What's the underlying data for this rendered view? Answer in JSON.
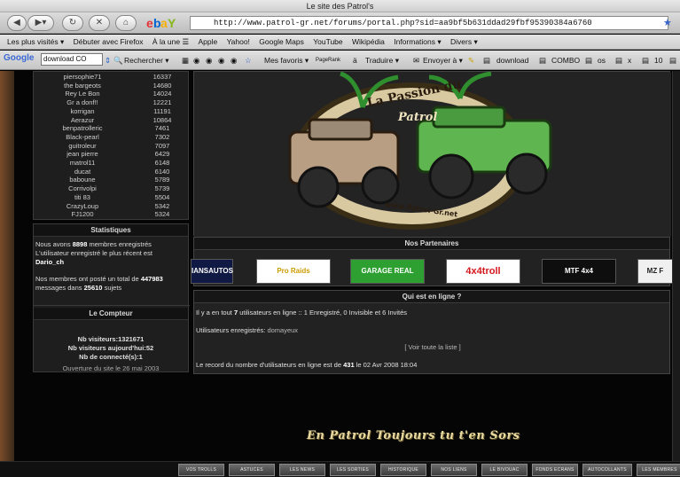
{
  "window": {
    "title": "Le site des Patrol's"
  },
  "url": "http://www.patrol-gr.net/forums/portal.php?sid=aa9bf5b631ddad29fbf95390384a6760",
  "bookmarks": [
    "Les plus visités ▾",
    "Débuter avec Firefox",
    "À la une ☰",
    "Apple",
    "Yahoo!",
    "Google Maps",
    "YouTube",
    "Wikipédia",
    "Informations ▾",
    "Divers ▾"
  ],
  "google_toolbar": {
    "search_value": "download CO",
    "search_label": "Rechercher ▾",
    "favorites": "Mes favoris ▾",
    "pagerank": "PageRank",
    "translate": "Traduire ▾",
    "send": "Envoyer à ▾",
    "items": [
      "download",
      "COMBO",
      "os",
      "x",
      "10"
    ]
  },
  "ranking": [
    {
      "name": "piersophie71",
      "value": "16337"
    },
    {
      "name": "the bargeots",
      "value": "14680"
    },
    {
      "name": "Rey Le Bon",
      "value": "14024"
    },
    {
      "name": "Gr a donf!!",
      "value": "12221"
    },
    {
      "name": "korrigan",
      "value": "11191"
    },
    {
      "name": "Aerazur",
      "value": "10864"
    },
    {
      "name": "benpatrolleric",
      "value": "7461"
    },
    {
      "name": "Black-pearl",
      "value": "7302"
    },
    {
      "name": "guitroleur",
      "value": "7097"
    },
    {
      "name": "jean pierre",
      "value": "6429"
    },
    {
      "name": "matrol11",
      "value": "6148"
    },
    {
      "name": "ducat",
      "value": "6140"
    },
    {
      "name": "baboune",
      "value": "5789"
    },
    {
      "name": "Corrivolpi",
      "value": "5739"
    },
    {
      "name": "titi 83",
      "value": "5504"
    },
    {
      "name": "CrazyLoup",
      "value": "5342"
    },
    {
      "name": "FJ1200",
      "value": "5324"
    }
  ],
  "stats": {
    "title": "Statistiques",
    "l1a": "Nous avons ",
    "members": "8898",
    "l1b": " membres enregistrés",
    "l2": "L'utilisateur enregistré le plus récent est",
    "newest": "Dario_ch",
    "l3a": "Nos membres ont posté un total de ",
    "posts": "447983",
    "l4a": "messages dans ",
    "topics": "25610",
    "l4b": " sujets"
  },
  "counter": {
    "title": "Le Compteur",
    "visitors_label": "Nb visiteurs:",
    "visitors": "1321671",
    "today_label": "Nb visiteurs aujourd'hui:",
    "today": "52",
    "connected_label": "Nb de connecté(s):",
    "connected": "1",
    "opening": "Ouverture du site le 26 mai 2003"
  },
  "logo": {
    "top_text": "La Passion du",
    "middle_text": "Patrol",
    "site_text": "www.Patrol-Gr.net"
  },
  "partners": {
    "title": "Nos Partenaires",
    "banners": [
      "IANSAUTOS",
      "Pro Raids",
      "GARAGE REAL",
      "4x4troll",
      "MTF 4x4",
      "MZ F"
    ]
  },
  "online": {
    "title": "Qui est en ligne ?",
    "line1a": "Il y a en tout ",
    "total": "7",
    "line1b": " utilisateurs en ligne :: 1 Enregistré, 0 Invisible et 6 Invités",
    "registered_label": "Utilisateurs enregistrés: ",
    "registered_user": "domayeux",
    "see_list": "[ Voir toute la liste ]",
    "record_a": "Le record du nombre d'utilisateurs en ligne est de ",
    "record": "431",
    "record_b": " le 02 Avr 2008 18:04"
  },
  "slogan": "En Patrol Toujours tu t'en Sors",
  "bottom_nav": [
    "VOS TROLLS",
    "ASTUCES",
    "LES NEWS",
    "LES SORTIES",
    "HISTORIQUE",
    "NOS LIENS",
    "LE BIVOUAC",
    "FONDS ECRANS",
    "AUTOCOLLANTS",
    "LES MEMBRES"
  ]
}
